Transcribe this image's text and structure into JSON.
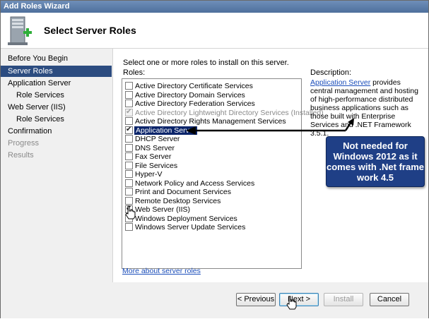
{
  "window": {
    "title": "Add Roles Wizard"
  },
  "header": {
    "title": "Select Server Roles",
    "icon": "server-add-icon"
  },
  "nav": {
    "items": [
      {
        "label": "Before You Begin",
        "state": "normal",
        "indent": false
      },
      {
        "label": "Server Roles",
        "state": "selected",
        "indent": false
      },
      {
        "label": "Application Server",
        "state": "normal",
        "indent": false
      },
      {
        "label": "Role Services",
        "state": "normal",
        "indent": true
      },
      {
        "label": "Web Server (IIS)",
        "state": "normal",
        "indent": false
      },
      {
        "label": "Role Services",
        "state": "normal",
        "indent": true
      },
      {
        "label": "Confirmation",
        "state": "normal",
        "indent": false
      },
      {
        "label": "Progress",
        "state": "disabled",
        "indent": false
      },
      {
        "label": "Results",
        "state": "disabled",
        "indent": false
      }
    ]
  },
  "content": {
    "instruction": "Select one or more roles to install on this server.",
    "roles_label": "Roles:",
    "description_label": "Description:",
    "roles": [
      {
        "label": "Active Directory Certificate Services",
        "checked": false,
        "disabled": false,
        "selected": false
      },
      {
        "label": "Active Directory Domain Services",
        "checked": false,
        "disabled": false,
        "selected": false
      },
      {
        "label": "Active Directory Federation Services",
        "checked": false,
        "disabled": false,
        "selected": false
      },
      {
        "label": "Active Directory Lightweight Directory Services  (Installed)",
        "checked": true,
        "disabled": true,
        "selected": false
      },
      {
        "label": "Active Directory Rights Management Services",
        "checked": false,
        "disabled": false,
        "selected": false
      },
      {
        "label": "Application Server",
        "checked": true,
        "disabled": false,
        "selected": true
      },
      {
        "label": "DHCP Server",
        "checked": false,
        "disabled": false,
        "selected": false
      },
      {
        "label": "DNS Server",
        "checked": false,
        "disabled": false,
        "selected": false
      },
      {
        "label": "Fax Server",
        "checked": false,
        "disabled": false,
        "selected": false
      },
      {
        "label": "File Services",
        "checked": false,
        "disabled": false,
        "selected": false
      },
      {
        "label": "Hyper-V",
        "checked": false,
        "disabled": false,
        "selected": false
      },
      {
        "label": "Network Policy and Access Services",
        "checked": false,
        "disabled": false,
        "selected": false
      },
      {
        "label": "Print and Document Services",
        "checked": false,
        "disabled": false,
        "selected": false
      },
      {
        "label": "Remote Desktop Services",
        "checked": false,
        "disabled": false,
        "selected": false
      },
      {
        "label": "Web Server (IIS)",
        "checked": true,
        "disabled": false,
        "selected": false
      },
      {
        "label": "Windows Deployment Services",
        "checked": false,
        "disabled": false,
        "selected": false
      },
      {
        "label": "Windows Server Update Services",
        "checked": false,
        "disabled": false,
        "selected": false
      }
    ],
    "description": {
      "link_text": "Application Server",
      "text": " provides central management and hosting of high-performance distributed business applications such as those built with Enterprise Services and .NET Framework 3.5.1."
    },
    "more_link": "More about server roles"
  },
  "callout": {
    "text": "Not needed for Windows 2012 as it comes with .Net frame work 4.5",
    "color": "#1f3f86"
  },
  "footer": {
    "previous_label": "< Previous",
    "next_label": "Next >",
    "install_label": "Install",
    "cancel_label": "Cancel"
  }
}
